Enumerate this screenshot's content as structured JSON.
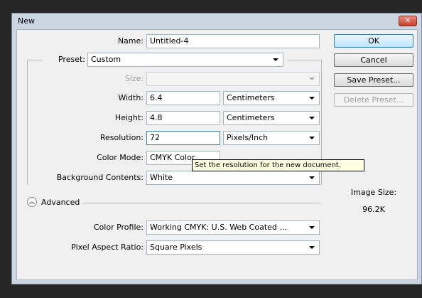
{
  "window": {
    "title": "New",
    "close_glyph": "✕"
  },
  "form": {
    "name": {
      "label": "Name:",
      "value": "Untitled-4"
    },
    "preset": {
      "label": "Preset:",
      "value": "Custom"
    },
    "size": {
      "label": "Size:",
      "value": ""
    },
    "width": {
      "label": "Width:",
      "value": "6.4",
      "unit": "Centimeters"
    },
    "height": {
      "label": "Height:",
      "value": "4.8",
      "unit": "Centimeters"
    },
    "resolution": {
      "label": "Resolution:",
      "value": "72",
      "unit": "Pixels/Inch"
    },
    "color_mode": {
      "label": "Color Mode:",
      "value": "CMYK Color"
    },
    "background": {
      "label": "Background Contents:",
      "value": "White"
    },
    "advanced": {
      "label": "Advanced",
      "icon": "collapse-chevrons-icon"
    },
    "color_profile": {
      "label": "Color Profile:",
      "value": "Working CMYK:  U.S. Web Coated ..."
    },
    "pixel_aspect": {
      "label": "Pixel Aspect Ratio:",
      "value": "Square Pixels"
    }
  },
  "buttons": {
    "ok": "OK",
    "cancel": "Cancel",
    "save_preset": "Save Preset...",
    "delete_preset": "Delete Preset..."
  },
  "image_size": {
    "label": "Image Size:",
    "value": "96.2K"
  },
  "tooltip": "Set the resolution for the new document."
}
